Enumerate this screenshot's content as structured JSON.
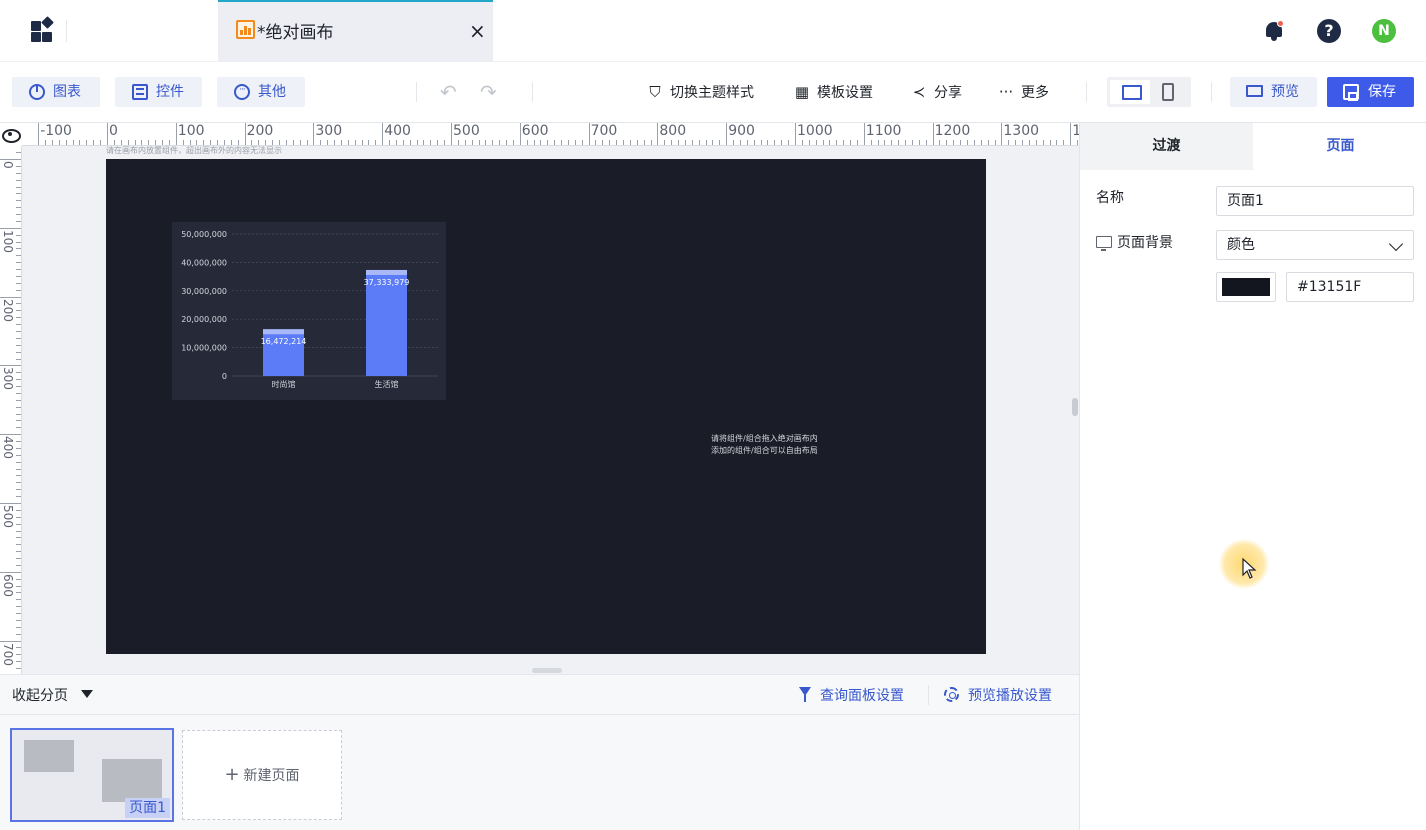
{
  "tab": {
    "title": "*绝对画布",
    "close": "×"
  },
  "topbar": {
    "avatar_letter": "N",
    "help_glyph": "?"
  },
  "toolbar": {
    "chart_label": "图表",
    "control_label": "控件",
    "other_label": "其他",
    "theme_label": "切换主题样式",
    "template_label": "模板设置",
    "share_label": "分享",
    "more_label": "更多",
    "preview_label": "预览",
    "save_label": "保存"
  },
  "ruler": {
    "h_labels": [
      "-100",
      "0",
      "100",
      "200",
      "300",
      "400",
      "500",
      "600",
      "700",
      "800",
      "900",
      "1000",
      "1100",
      "1200",
      "1300",
      "1"
    ],
    "v_labels": [
      "0",
      "100",
      "200",
      "300",
      "400",
      "500",
      "600",
      "700"
    ]
  },
  "canvas": {
    "note": "请在画布内放置组件，超出画布外的内容无法显示",
    "hint_line1": "请将组件/组合拖入绝对画布内",
    "hint_line2": "添加的组件/组合可以自由布局"
  },
  "chart_data": {
    "type": "bar",
    "categories": [
      "时尚馆",
      "生活馆"
    ],
    "values": [
      16472214,
      37333979
    ],
    "data_labels": [
      "16,472,214",
      "37,333,979"
    ],
    "y_ticks": [
      "0",
      "10,000,000",
      "20,000,000",
      "30,000,000",
      "40,000,000",
      "50,000,000"
    ],
    "ylim": [
      0,
      50000000
    ],
    "grid": true,
    "bar_color": "#5b7cf6",
    "cap_color": "#a9b9f7"
  },
  "panel": {
    "tab_transition": "过渡",
    "tab_page": "页面",
    "name_label": "名称",
    "name_value": "页面1",
    "bg_label": "页面背景",
    "bg_type": "颜色",
    "bg_color_hex": "#13151F",
    "bg_color": "#13151F"
  },
  "bottom": {
    "collapse_label": "收起分页",
    "query_panel_label": "查询面板设置",
    "preview_play_label": "预览播放设置",
    "page1_label": "页面1",
    "new_page_label": "新建页面"
  }
}
